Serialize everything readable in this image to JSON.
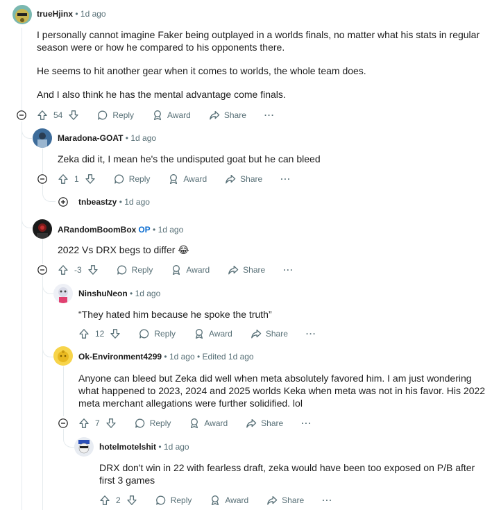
{
  "comments": [
    {
      "author": "trueHjinx",
      "time": "1d ago",
      "body": [
        "I personally cannot imagine Faker being outplayed in a worlds finals, no matter what his stats in regular season were or how he compared to his opponents there.",
        "He seems to hit another gear when it comes to worlds, the whole team does.",
        "And I also think he has the mental advantage come finals."
      ],
      "score": "54"
    },
    {
      "author": "Maradona-GOAT",
      "time": "1d ago",
      "body": [
        "Zeka did it, I mean he's the undisputed goat but he can bleed"
      ],
      "score": "1"
    },
    {
      "author": "tnbeastzy",
      "time": "1d ago"
    },
    {
      "author": "ARandomBoomBox",
      "op_badge": "OP",
      "time": "1d ago",
      "body": [
        "2022 Vs DRX begs to differ 😂"
      ],
      "score": "-3"
    },
    {
      "author": "NinshuNeon",
      "time": "1d ago",
      "body": [
        "“They hated him because he spoke the truth”"
      ],
      "score": "12"
    },
    {
      "author": "Ok-Environment4299",
      "time": "1d ago",
      "edited": "Edited 1d ago",
      "body": [
        "Anyone can bleed but Zeka did well when meta absolutely favored him. I am just wondering what happened to 2023, 2024 and 2025 worlds Keka when meta was not in his favor. His 2022 meta merchant allegations were further solidified. lol"
      ],
      "score": "7"
    },
    {
      "author": "hotelmotelshit",
      "time": "1d ago",
      "body": [
        "DRX don't win in 22 with fearless draft, zeka would have been too exposed on P/B after first 3 games"
      ],
      "score": "2"
    }
  ],
  "labels": {
    "reply": "Reply",
    "award": "Award",
    "share": "Share",
    "more": "···",
    "dot": "•"
  },
  "icons": [
    "upvote-icon",
    "downvote-icon",
    "reply-icon",
    "award-icon",
    "share-icon",
    "collapse-icon",
    "expand-icon"
  ],
  "colors": {
    "meta": "#576f76",
    "op": "#0a6cd0",
    "thread_line": "#e5ebee"
  }
}
